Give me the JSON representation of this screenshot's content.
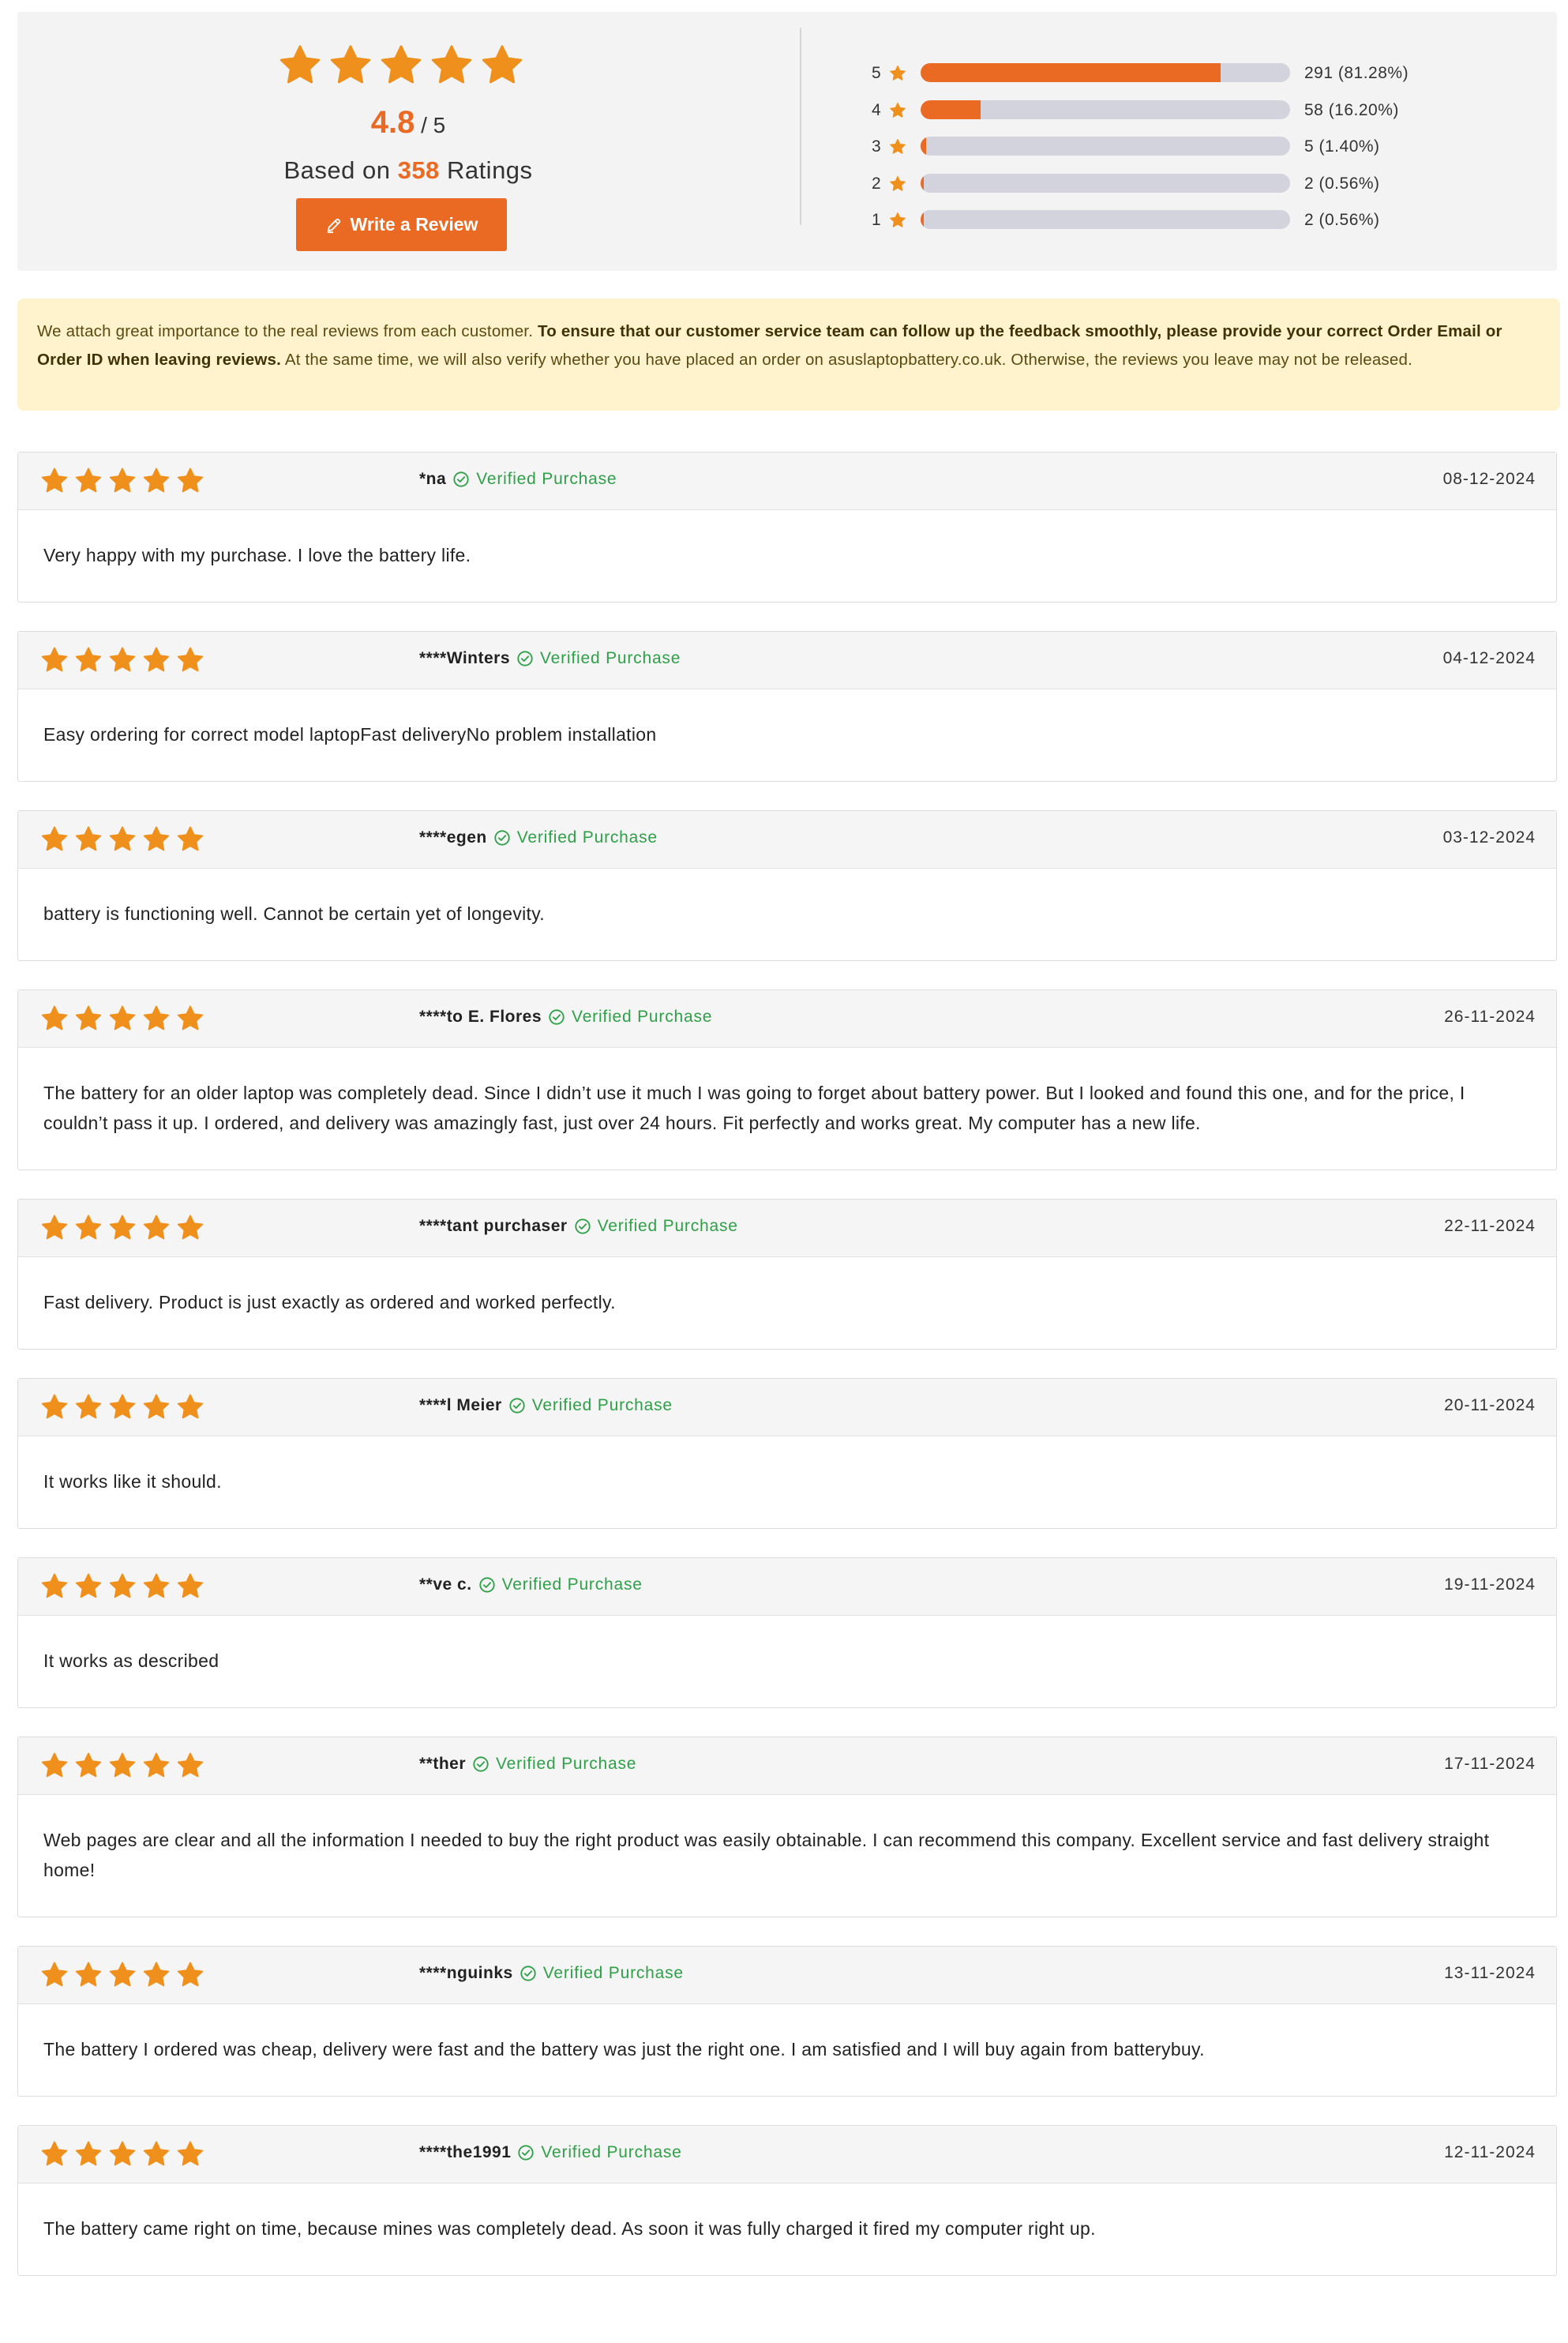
{
  "summary": {
    "average": "4.8",
    "out_of": "/ 5",
    "based_prefix": "Based on",
    "count": "358",
    "based_suffix": "Ratings",
    "star_rating": 5,
    "write_review_label": "Write a Review",
    "distribution": [
      {
        "stars": "5",
        "text": "291 (81.28%)",
        "fraction": 0.8128
      },
      {
        "stars": "4",
        "text": "58 (16.20%)",
        "fraction": 0.162
      },
      {
        "stars": "3",
        "text": "5 (1.40%)",
        "fraction": 0.014
      },
      {
        "stars": "2",
        "text": "2 (0.56%)",
        "fraction": 0.0056
      },
      {
        "stars": "1",
        "text": "2 (0.56%)",
        "fraction": 0.0056
      }
    ]
  },
  "notice": {
    "part1": "We attach great importance to the real reviews from each customer. ",
    "bold": "To ensure that our customer service team can follow up the feedback smoothly, please provide your correct Order Email or Order ID when leaving reviews.",
    "part2": " At the same time, we will also verify whether you have placed an order on asuslaptopbattery.co.uk. Otherwise, the reviews you leave may not be released."
  },
  "verified_label": "Verified Purchase",
  "colors": {
    "accent": "#ea6a23",
    "star": "#f0901c",
    "verified": "#2ea048",
    "notice_bg": "#fef3cd"
  },
  "reviews": [
    {
      "author": "*na",
      "date": "08-12-2024",
      "rating": 5,
      "text": "Very happy with my purchase. I love the battery life."
    },
    {
      "author": "****Winters",
      "date": "04-12-2024",
      "rating": 5,
      "text": "Easy ordering for correct model laptopFast deliveryNo problem installation"
    },
    {
      "author": "****egen",
      "date": "03-12-2024",
      "rating": 5,
      "text": "battery is functioning well. Cannot be certain yet of longevity."
    },
    {
      "author": "****to E. Flores",
      "date": "26-11-2024",
      "rating": 5,
      "text": "The battery for an older laptop was completely dead. Since I didn’t use it much I was going to forget about battery power. But I looked and found this one, and for the price, I couldn’t pass it up. I ordered, and delivery was amazingly fast, just over 24 hours. Fit perfectly and works great. My computer has a new life."
    },
    {
      "author": "****tant purchaser",
      "date": "22-11-2024",
      "rating": 5,
      "text": "Fast delivery. Product is just exactly as ordered and worked perfectly."
    },
    {
      "author": "****l Meier",
      "date": "20-11-2024",
      "rating": 5,
      "text": "It works like it should."
    },
    {
      "author": "**ve c.",
      "date": "19-11-2024",
      "rating": 5,
      "text": "It works as described"
    },
    {
      "author": "**ther",
      "date": "17-11-2024",
      "rating": 5,
      "text": "Web pages are clear and all the information I needed to buy the right product was easily obtainable. I can recommend this company. Excellent service and fast delivery straight home!"
    },
    {
      "author": "****nguinks",
      "date": "13-11-2024",
      "rating": 5,
      "text": "The battery I ordered was cheap, delivery were fast and the battery was just the right one. I am satisfied and I will buy again from batterybuy."
    },
    {
      "author": "****the1991",
      "date": "12-11-2024",
      "rating": 5,
      "text": "The battery came right on time, because mines was completely dead. As soon it was fully charged it fired my computer right up."
    }
  ]
}
